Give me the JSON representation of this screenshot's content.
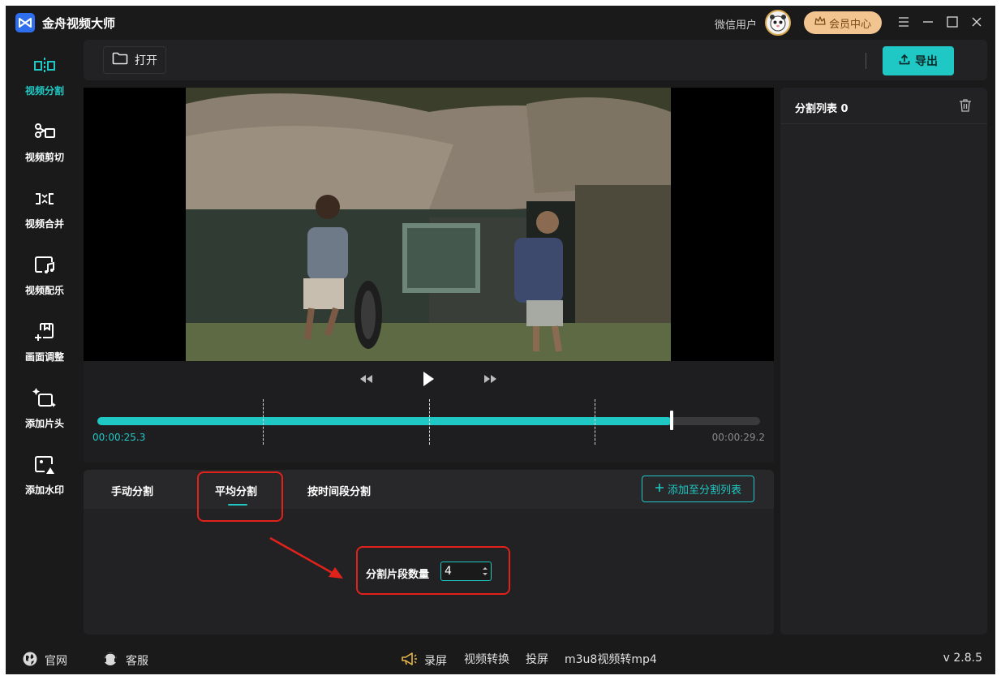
{
  "app": {
    "title": "金舟视频大师",
    "version": "v 2.8.5"
  },
  "account": {
    "user_name": "微信用户",
    "vip_label": "会员中心"
  },
  "sidebar": {
    "items": [
      {
        "label": "视频分割",
        "icon": "split-icon",
        "active": true
      },
      {
        "label": "视频剪切",
        "icon": "scissors-icon",
        "active": false
      },
      {
        "label": "视频合并",
        "icon": "merge-icon",
        "active": false
      },
      {
        "label": "视频配乐",
        "icon": "music-icon",
        "active": false
      },
      {
        "label": "画面调整",
        "icon": "adjust-icon",
        "active": false
      },
      {
        "label": "添加片头",
        "icon": "intro-icon",
        "active": false
      },
      {
        "label": "添加水印",
        "icon": "watermark-icon",
        "active": false
      }
    ]
  },
  "toolbar": {
    "open_label": "打开",
    "export_label": "导出"
  },
  "player": {
    "current_time": "00:00:25.3",
    "total_time": "00:00:29.2",
    "progress": 0.866,
    "split_marks": [
      0.25,
      0.5,
      0.75
    ]
  },
  "split": {
    "tabs": [
      {
        "label": "手动分割"
      },
      {
        "label": "平均分割",
        "active": true
      },
      {
        "label": "按时间段分割"
      }
    ],
    "add_to_list_label": "添加至分割列表",
    "count_label": "分割片段数量",
    "count_value": "4"
  },
  "list": {
    "title": "分割列表 0"
  },
  "footer": {
    "website": "官网",
    "support": "客服",
    "links": [
      "录屏",
      "视频转换",
      "投屏",
      "m3u8视频转mp4"
    ]
  },
  "colors": {
    "accent": "#1fc8c4",
    "annotation": "#e0221a",
    "vip": "#f2c48f"
  }
}
